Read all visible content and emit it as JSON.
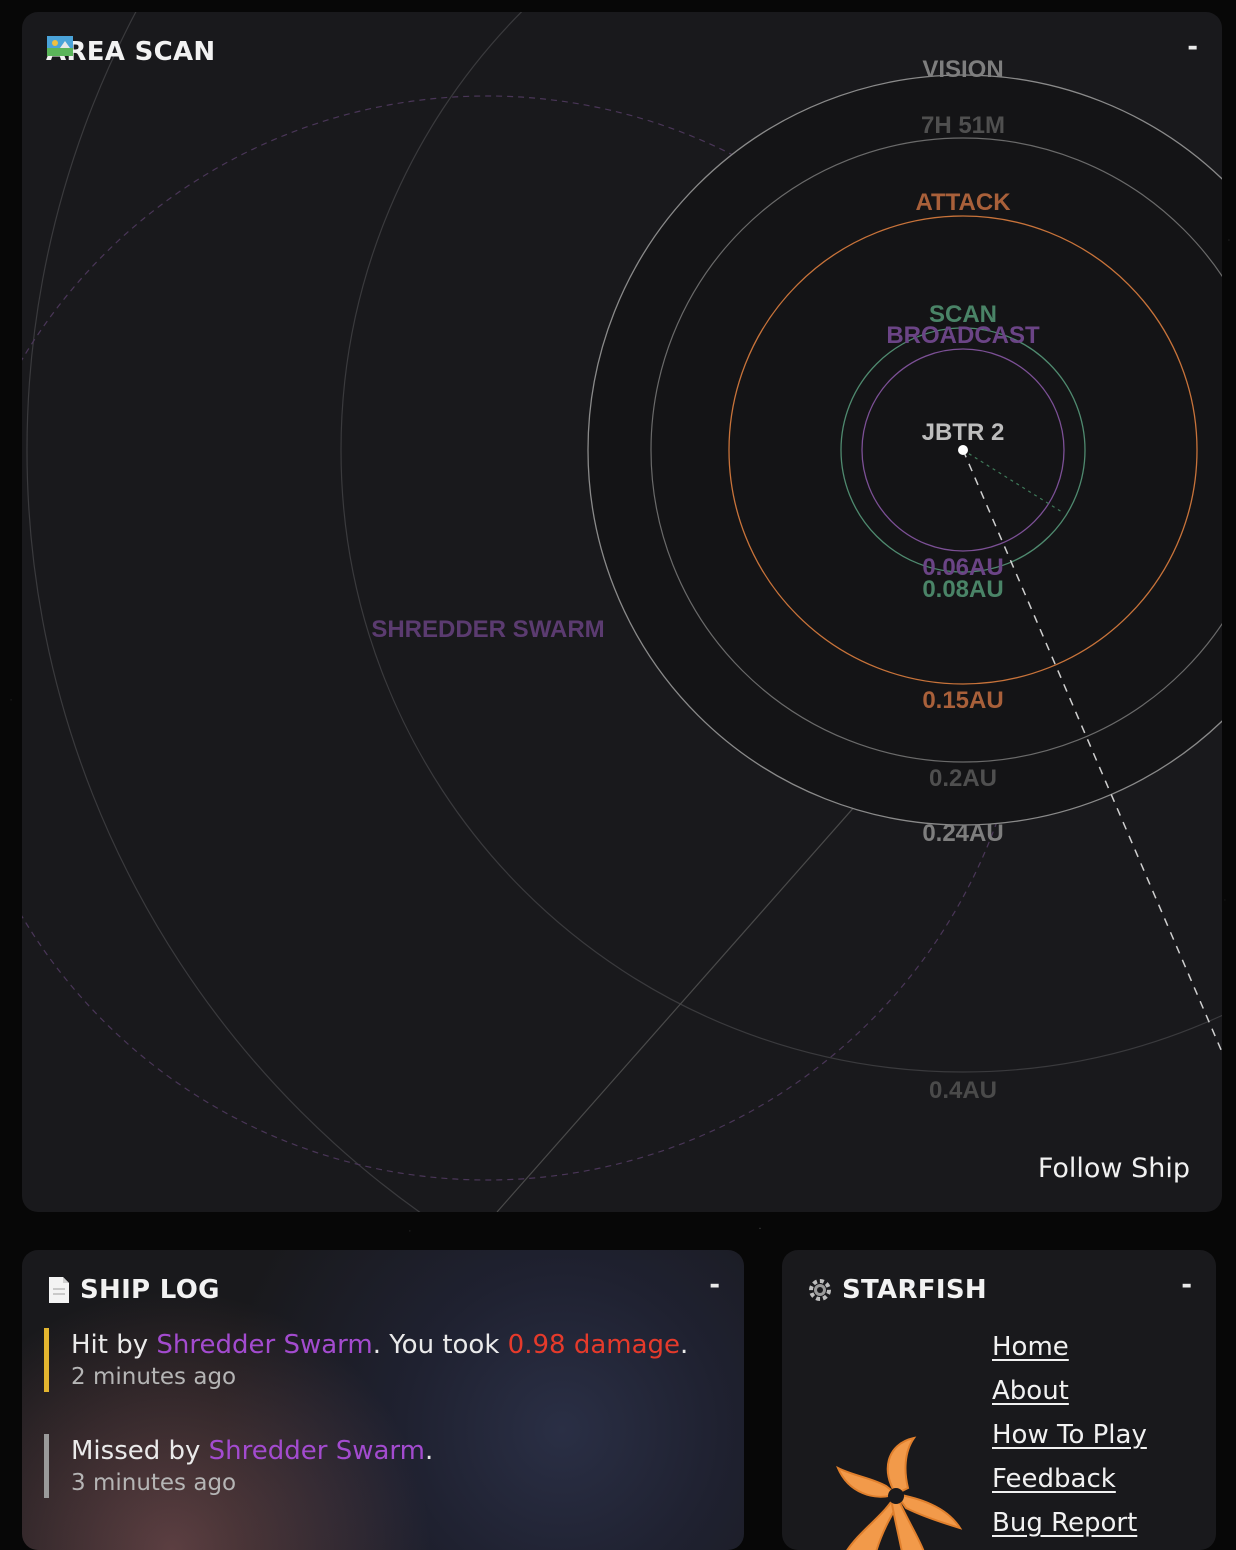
{
  "area_scan": {
    "icon": "map-icon",
    "title": "AREA SCAN",
    "collapse_label": "-",
    "ship_name": "JBTR 2",
    "ring_labels": {
      "vision": "VISION",
      "timer": "7H 51M",
      "attack": "ATTACK",
      "scan": "SCAN",
      "broadcast": "BROADCAST"
    },
    "distance_labels": {
      "broadcast": "0.06AU",
      "scan": "0.08AU",
      "attack": "0.15AU",
      "timer": "0.2AU",
      "vision": "0.24AU",
      "outer": "0.4AU"
    },
    "enemy_name": "SHREDDER SWARM",
    "follow_label": "Follow Ship",
    "colors": {
      "attack": "#c8733a",
      "scan": "#4f8a6f",
      "broadcast": "#7c5096",
      "enemy": "#5b3b70",
      "ring": "#8a8a8a"
    }
  },
  "ship_log": {
    "icon": "document-icon",
    "title": "SHIP LOG",
    "collapse_label": "-",
    "entries": [
      {
        "prefix": "Hit by ",
        "enemy": "Shredder Swarm",
        "middle": ". You took ",
        "damage": "0.98 damage",
        "suffix": ".",
        "time": "2 minutes ago",
        "accent": "#e3b52f"
      },
      {
        "prefix": "Missed by ",
        "enemy": "Shredder Swarm",
        "suffix": ".",
        "time": "3 minutes ago",
        "accent": "#9a9a9a"
      }
    ]
  },
  "starfish": {
    "icon": "gear-icon",
    "title": "STARFISH",
    "collapse_label": "-",
    "logo": "starfish-logo",
    "links": [
      "Home",
      "About",
      "How To Play",
      "Feedback",
      "Bug Report"
    ]
  }
}
